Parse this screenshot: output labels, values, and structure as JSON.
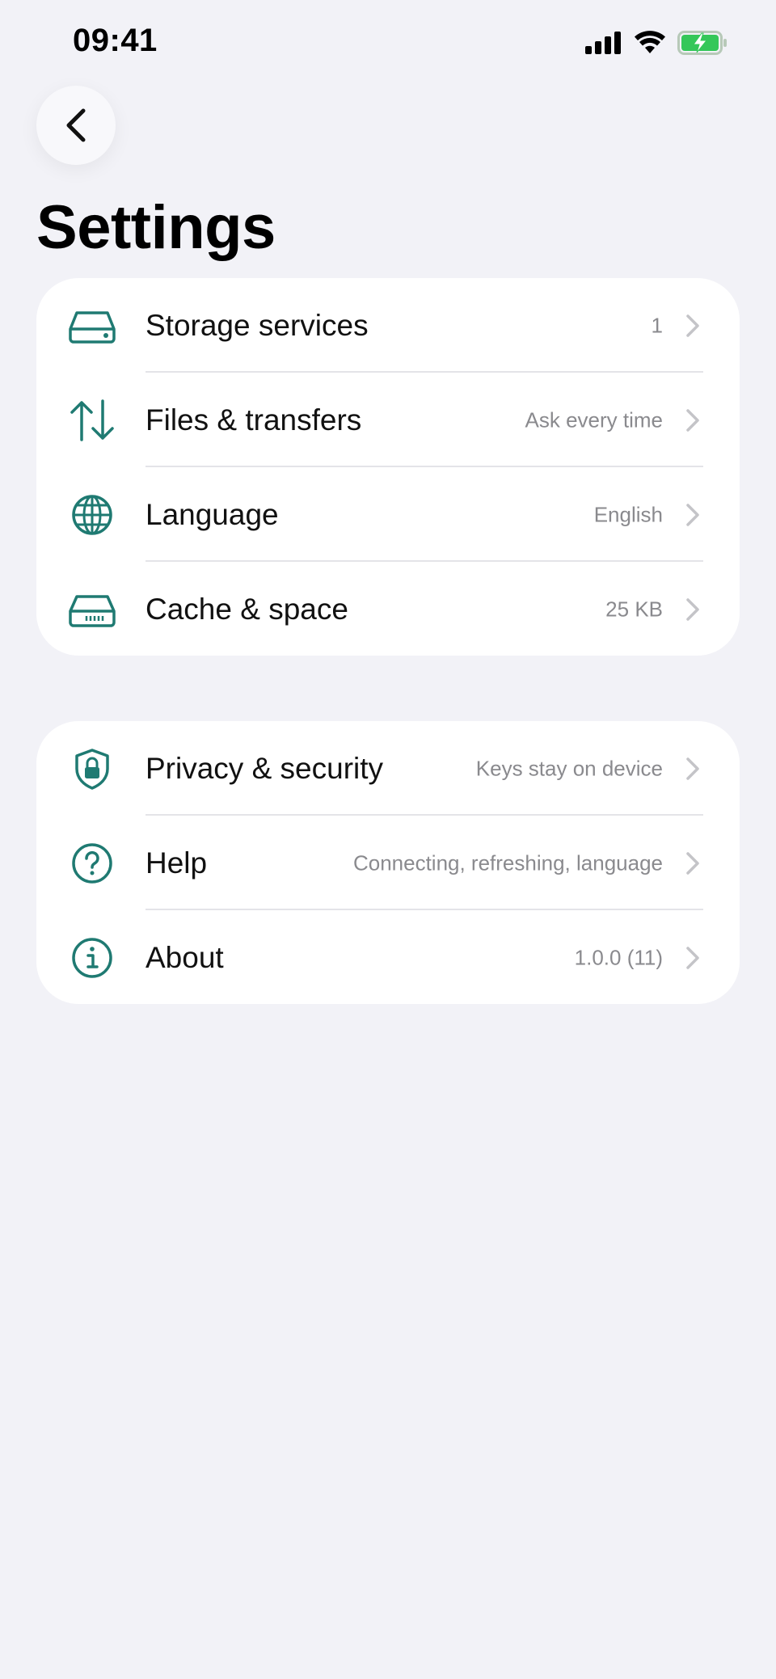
{
  "status_bar": {
    "time": "09:41"
  },
  "header": {
    "back_icon": "chevron-left-icon",
    "title": "Settings"
  },
  "colors": {
    "accent": "#1f7a72",
    "background": "#f2f2f7",
    "battery": "#34c759"
  },
  "groups": [
    {
      "items": [
        {
          "icon": "hard-drive-icon",
          "label": "Storage services",
          "value": "1"
        },
        {
          "icon": "arrows-up-down-icon",
          "label": "Files & transfers",
          "value": "Ask every time"
        },
        {
          "icon": "globe-icon",
          "label": "Language",
          "value": "English"
        },
        {
          "icon": "drive-cache-icon",
          "label": "Cache & space",
          "value": "25 KB"
        }
      ]
    },
    {
      "items": [
        {
          "icon": "shield-lock-icon",
          "label": "Privacy & security",
          "value": "Keys stay on device"
        },
        {
          "icon": "question-circle-icon",
          "label": "Help",
          "value": "Connecting, refreshing, language"
        },
        {
          "icon": "info-circle-icon",
          "label": "About",
          "value": "1.0.0 (11)"
        }
      ]
    }
  ]
}
